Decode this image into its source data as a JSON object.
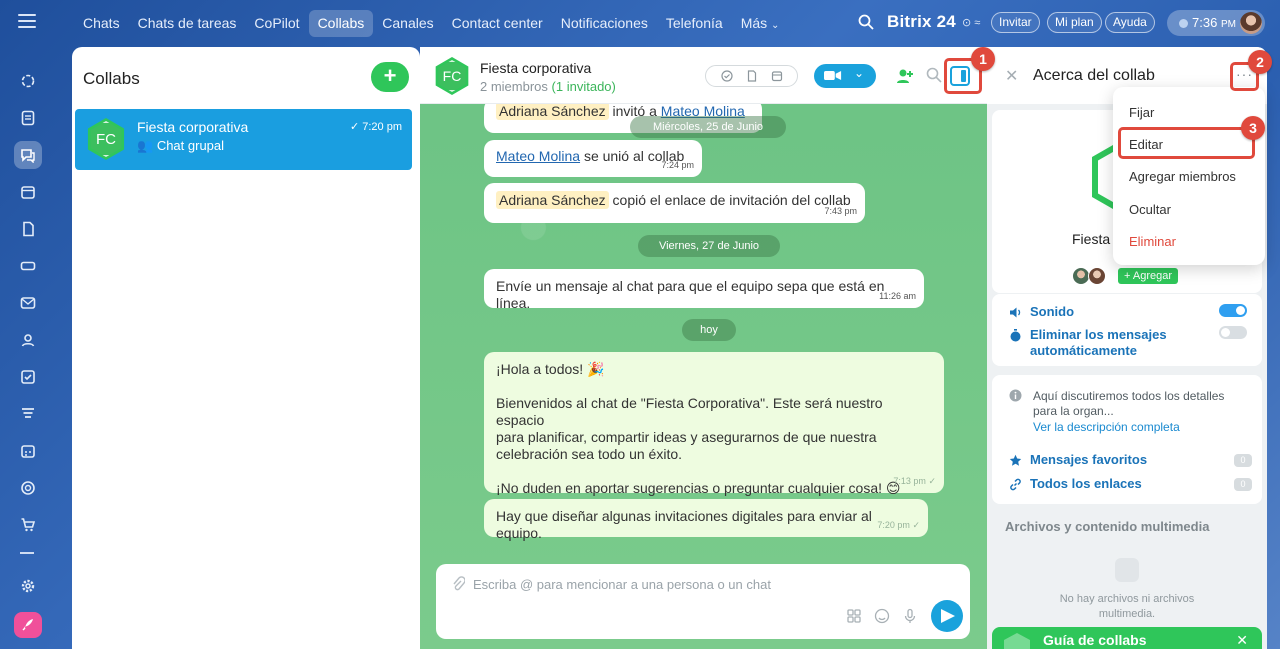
{
  "topbar": {
    "tabs": [
      "Chats",
      "Chats de tareas",
      "CoPilot",
      "Collabs",
      "Canales",
      "Contact center",
      "Notificaciones",
      "Telefonía",
      "Más"
    ],
    "active_tab": "Collabs",
    "brand": "Bitrix",
    "brand_number": "24",
    "invite_label": "Invitar",
    "plan_label": "Mi plan",
    "help_label": "Ayuda",
    "clock_time": "7:36",
    "clock_suffix": "PM"
  },
  "left_panel": {
    "title": "Collabs",
    "add_label": "+",
    "items": [
      {
        "avatar": "FC",
        "name": "Fiesta corporativa",
        "subtitle": "Chat grupal",
        "time": "7:20 pm"
      }
    ]
  },
  "chat": {
    "avatar": "FC",
    "title": "Fiesta corporativa",
    "members": "2 miembros",
    "invited": "(1 invitado)",
    "messages": [
      {
        "mention": "Adriana Sánchez",
        "text": "invitó a",
        "link": "Mateo Molina"
      },
      {
        "link": "Mateo Molina",
        "text": "se unió al collab",
        "time": "7:24 pm"
      },
      {
        "mention": "Adriana Sánchez",
        "text": "copió el enlace de invitación del collab",
        "time": "7:43 pm"
      },
      {
        "text": "Envíe un mensaje al chat para que el equipo sepa que está en línea.",
        "time": "11:26 am"
      },
      {
        "lines": [
          "¡Hola a todos! 🎉",
          "",
          "Bienvenidos al chat de \"Fiesta Corporativa\". Este será nuestro espacio",
          "para planificar, compartir ideas y asegurarnos de que nuestra",
          "celebración sea todo un éxito.",
          "",
          "¡No duden en aportar sugerencias o preguntar cualquier cosa! 😊"
        ],
        "time": "7:13 pm"
      },
      {
        "text": "Hay que diseñar algunas invitaciones digitales para enviar al equipo.",
        "time": "7:20 pm"
      }
    ],
    "dates": [
      "Miércoles, 25 de Junio",
      "Viernes, 27 de Junio",
      "hoy"
    ],
    "overlap_time": "7:20 pm",
    "composer_placeholder": "Escriba @ para mencionar a una persona o un chat"
  },
  "right_panel": {
    "title": "Acerca del collab",
    "collab_name": "Fiesta c",
    "add_members": "+ Agregar",
    "sound_label": "Sonido",
    "sound_on": true,
    "autodelete_label_1": "Eliminar los mensajes",
    "autodelete_label_2": "automáticamente",
    "autodelete_on": false,
    "description_1": "Aquí discutiremos todos los detalles",
    "description_2": "para la organ...",
    "description_link": "Ver la descripción completa",
    "favorites_label": "Mensajes favoritos",
    "favorites_count": "0",
    "links_label": "Todos los enlaces",
    "links_count": "0",
    "files_title": "Archivos y contenido multimedia",
    "files_empty_1": "No hay archivos ni archivos",
    "files_empty_2": "multimedia.",
    "guide_label": "Guía de collabs"
  },
  "menu": {
    "items": [
      "Fijar",
      "Editar",
      "Agregar miembros",
      "Ocultar",
      "Eliminar"
    ]
  },
  "annotations": {
    "step1": "1",
    "step2": "2",
    "step3": "3"
  },
  "colors": {
    "accent_blue": "#1aa2dc",
    "green": "#2fc65a",
    "highlight_red": "#e0493c",
    "chat_bg": "#74c78a"
  }
}
